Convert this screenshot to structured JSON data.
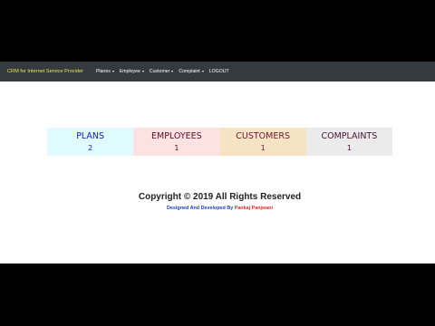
{
  "navbar": {
    "brand": "CRM for Internet Service Provider",
    "items": [
      {
        "label": "Planes",
        "dropdown": true
      },
      {
        "label": "Employee",
        "dropdown": true
      },
      {
        "label": "Customer",
        "dropdown": true
      },
      {
        "label": "Complaint",
        "dropdown": true
      },
      {
        "label": "LOGOUT",
        "dropdown": false
      }
    ]
  },
  "stats": [
    {
      "label": "PLANS",
      "value": "2",
      "bg": "#e0fbfd",
      "color": "#1a1aa8"
    },
    {
      "label": "EMPLOYEES",
      "value": "1",
      "bg": "#fde2e2",
      "color": "#5a0f2a"
    },
    {
      "label": "CUSTOMERS",
      "value": "1",
      "bg": "#f6e3c3",
      "color": "#6a1a3a"
    },
    {
      "label": "COMPLAINTS",
      "value": "1",
      "bg": "#ebebeb",
      "color": "#4a0f3a"
    }
  ],
  "footer": {
    "copyright": "Copyright © 2019 All Rights Reserved",
    "designed_by": "Designed And Developed By ",
    "author": "Pankaj Panjwani"
  }
}
